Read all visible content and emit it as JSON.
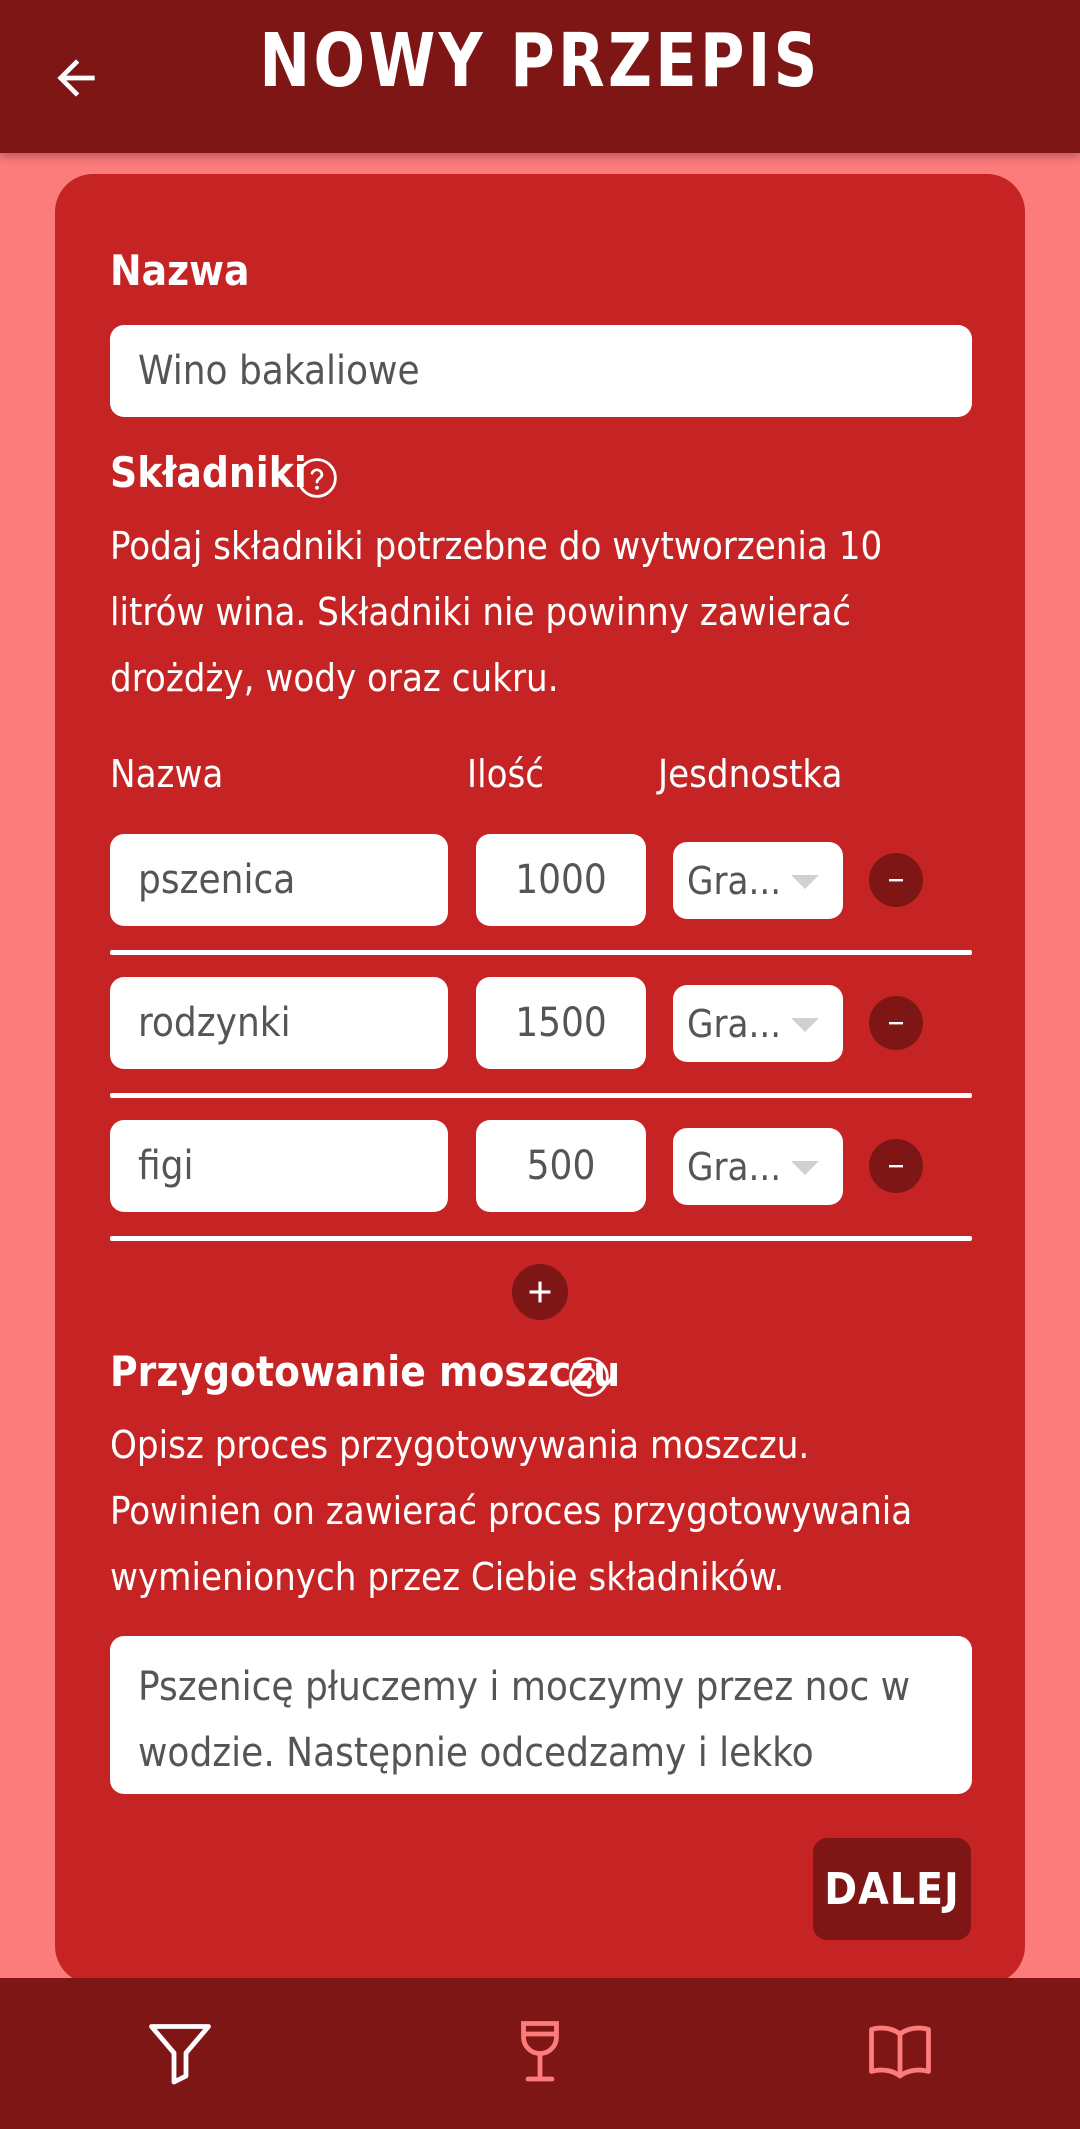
{
  "header": {
    "title": "NOWY PRZEPIS",
    "back_icon": "arrow-left-icon"
  },
  "form": {
    "name_label": "Nazwa",
    "name_value": "Wino bakaliowe",
    "ingredients_label": "Składniki",
    "ingredients_desc": "Podaj składniki potrzebne do wytworzenia 10 litrów wina. Składniki nie powinny zawierać drożdży, wody oraz cukru.",
    "columns": {
      "name": "Nazwa",
      "qty": "Ilość",
      "unit": "Jesdnostka"
    },
    "ingredients": [
      {
        "name": "pszenica",
        "qty": "1000",
        "unit": "Gra..."
      },
      {
        "name": "rodzynki",
        "qty": "1500",
        "unit": "Gra..."
      },
      {
        "name": "figi",
        "qty": "500",
        "unit": "Gra..."
      }
    ],
    "must_label": "Przygotowanie moszczu",
    "must_desc": "Opisz proces przygotowywania moszczu. Powinien on zawierać proces przygotowywania wymienionych przez Ciebie składników.",
    "must_value": "Pszenicę płuczemy i moczymy przez noc w wodzie. Następnie odcedzamy i lekko rozgniatamy. Rodzynki",
    "next_label": "DALEJ"
  },
  "bottom_nav": {
    "items": [
      "filter-icon",
      "wine-glass-icon",
      "book-icon"
    ],
    "colors": {
      "inactive": "#ffffff",
      "active": "#fc7b7b"
    }
  },
  "colors": {
    "background": "#fc7b7b",
    "appbar": "#7e1616",
    "card": "#c62424"
  }
}
